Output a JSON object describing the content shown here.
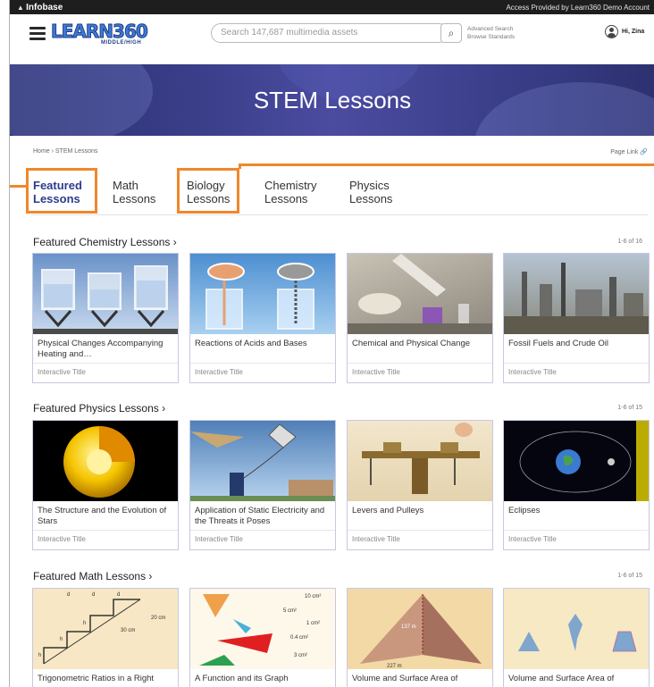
{
  "topbar": {
    "brand": "Infobase",
    "access": "Access Provided by Learn360 Demo Account"
  },
  "header": {
    "logo_text": "LEARN360",
    "logo_sub": "MIDDLE/HIGH",
    "search_placeholder": "Search 147,687 multimedia assets",
    "advanced_search": "Advanced Search",
    "browse_standards": "Browse Standards",
    "user_greeting": "Hi, Zina"
  },
  "banner": {
    "title": "STEM Lessons"
  },
  "breadcrumb": "Home › STEM Lessons",
  "page_link": "Page Link",
  "tabs": [
    {
      "line1": "Featured",
      "line2": "Lessons"
    },
    {
      "line1": "Math",
      "line2": "Lessons"
    },
    {
      "line1": "Biology",
      "line2": "Lessons"
    },
    {
      "line1": "Chemistry",
      "line2": "Lessons"
    },
    {
      "line1": "Physics",
      "line2": "Lessons"
    }
  ],
  "sections": [
    {
      "title": "Featured Chemistry Lessons ›",
      "count": "1-6 of 16",
      "cards": [
        {
          "title": "Physical Changes Accompanying Heating and…",
          "type": "Interactive Title"
        },
        {
          "title": "Reactions of Acids and Bases",
          "type": "Interactive Title"
        },
        {
          "title": "Chemical and Physical Change",
          "type": "Interactive Title"
        },
        {
          "title": "Fossil Fuels and Crude Oil",
          "type": "Interactive Title"
        }
      ]
    },
    {
      "title": "Featured Physics Lessons ›",
      "count": "1-6 of 15",
      "cards": [
        {
          "title": "The Structure and the Evolution of Stars",
          "type": "Interactive Title"
        },
        {
          "title": "Application of Static Electricity and the Threats it Poses",
          "type": "Interactive Title"
        },
        {
          "title": "Levers and Pulleys",
          "type": "Interactive Title"
        },
        {
          "title": "Eclipses",
          "type": "Interactive Title"
        }
      ]
    },
    {
      "title": "Featured Math Lessons ›",
      "count": "1-6 of 15",
      "cards": [
        {
          "title": "Trigonometric Ratios in a Right",
          "type": ""
        },
        {
          "title": "A Function and its Graph",
          "type": ""
        },
        {
          "title": "Volume and Surface Area of",
          "type": ""
        },
        {
          "title": "Volume and Surface Area of",
          "type": ""
        }
      ]
    }
  ],
  "thumb_labels": {
    "stairs": [
      "d",
      "d",
      "d",
      "20 cm",
      "30 cm",
      "h",
      "h",
      "h"
    ],
    "function": [
      "10 cm²",
      "5 cm²",
      "1 cm²",
      "0.4 cm²",
      "3 cm²"
    ],
    "pyramid": [
      "137 m",
      "227 m"
    ]
  },
  "colors": {
    "accent": "#f0872c",
    "brand": "#2e3b8d",
    "banner": "#3b3f8a"
  }
}
